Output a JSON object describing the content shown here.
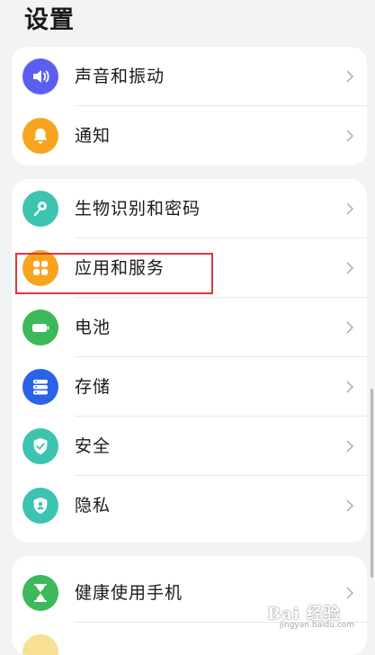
{
  "page_title": "设置",
  "groups": [
    {
      "items": [
        {
          "label": "声音和振动",
          "icon": "speaker-icon",
          "color": "#5b5ff0"
        },
        {
          "label": "通知",
          "icon": "bell-icon",
          "color": "#f7a520"
        }
      ]
    },
    {
      "items": [
        {
          "label": "生物识别和密码",
          "icon": "key-icon",
          "color": "#3cc4b1"
        },
        {
          "label": "应用和服务",
          "icon": "apps-grid-icon",
          "color": "#f7a520"
        },
        {
          "label": "电池",
          "icon": "battery-icon",
          "color": "#3db85a"
        },
        {
          "label": "存储",
          "icon": "storage-icon",
          "color": "#2a63e6"
        },
        {
          "label": "安全",
          "icon": "shield-check-icon",
          "color": "#3cc4b1"
        },
        {
          "label": "隐私",
          "icon": "privacy-shield-icon",
          "color": "#3cc4b1"
        }
      ]
    },
    {
      "items": [
        {
          "label": "健康使用手机",
          "icon": "hourglass-icon",
          "color": "#3db85a"
        }
      ]
    }
  ],
  "watermark": {
    "brand": "Bai 经验",
    "url": "jingyan.baidu.com"
  },
  "highlight_color": "#d9363e"
}
